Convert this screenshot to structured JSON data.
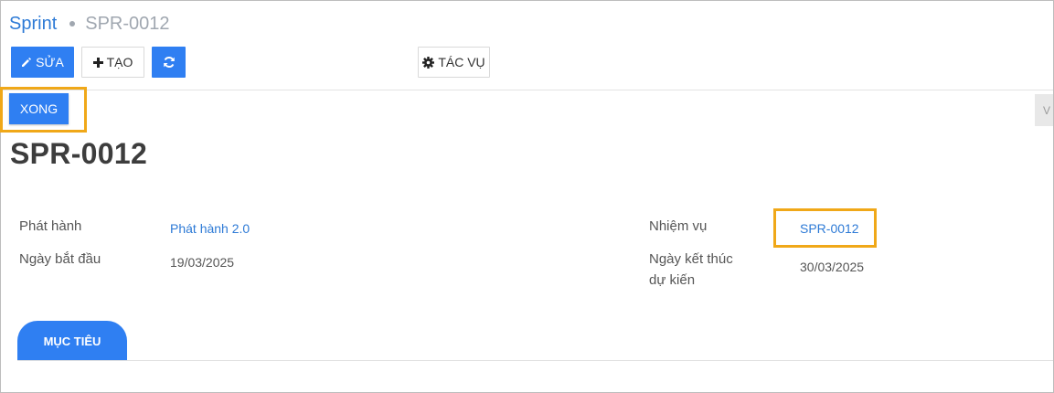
{
  "breadcrumb": {
    "parent": "Sprint",
    "current": "SPR-0012"
  },
  "toolbar": {
    "edit_label": "SỬA",
    "create_label": "TẠO",
    "action_label": "TÁC VỤ"
  },
  "status": {
    "label": "XONG"
  },
  "record": {
    "title": "SPR-0012"
  },
  "fields": {
    "release_label": "Phát hành",
    "release_value": "Phát hành 2.0",
    "start_date_label": "Ngày bắt đầu",
    "start_date_value": "19/03/2025",
    "task_label": "Nhiệm vụ",
    "task_value": "SPR-0012",
    "end_date_label_line1": "Ngày kết thúc",
    "end_date_label_line2": "dự kiến",
    "end_date_value": "30/03/2025"
  },
  "tabs": [
    {
      "label": "MỤC TIÊU"
    }
  ],
  "colors": {
    "primary": "#2f7ff2",
    "link": "#2d7ad6",
    "highlight": "#f0a818"
  },
  "icons": {
    "edit": "pencil-icon",
    "create": "plus-icon",
    "refresh": "refresh-icon",
    "action": "gear-icon"
  }
}
